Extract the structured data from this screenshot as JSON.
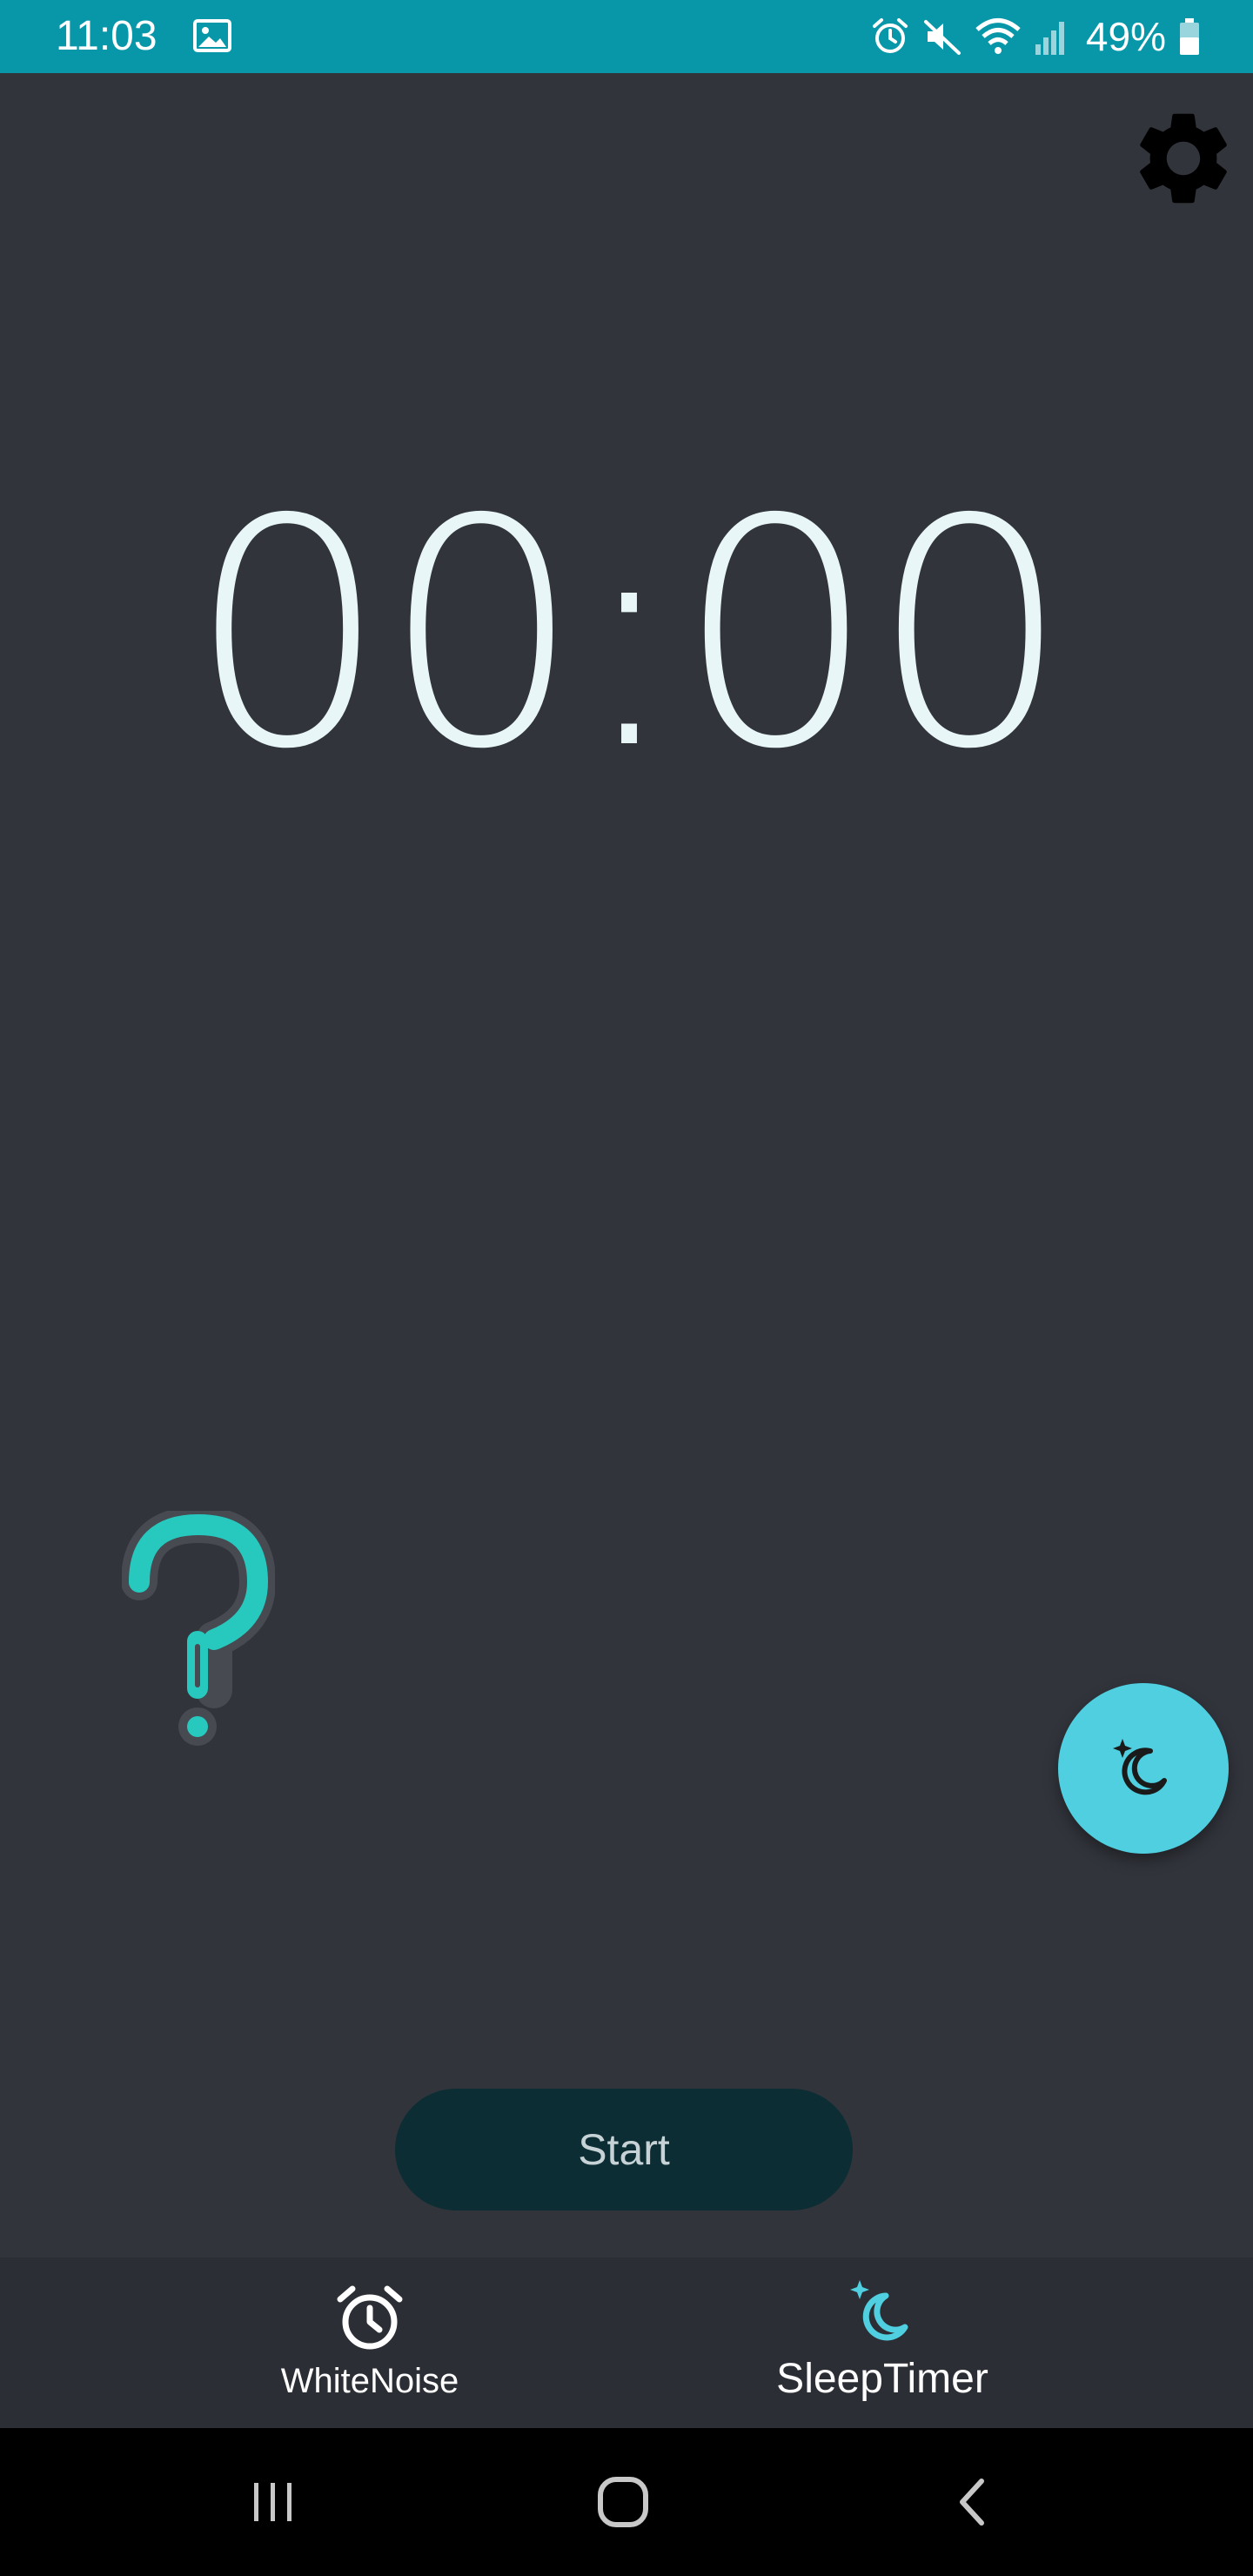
{
  "status_bar": {
    "time": "11:03",
    "battery": "49%",
    "icons": [
      "gallery-icon",
      "alarm-icon",
      "mute-icon",
      "wifi-icon",
      "signal-icon",
      "battery-icon"
    ],
    "color": "#0797a9"
  },
  "settings": {
    "icon": "gear-icon"
  },
  "timer": {
    "display": "00:00",
    "color": "#e8f6f8"
  },
  "help": {
    "icon": "question-mark-icon",
    "color": "#27c9be"
  },
  "fab": {
    "icon": "moon-star-icon",
    "color": "#4fcfdf"
  },
  "start_button": {
    "label": "Start",
    "color": "#0b2d33"
  },
  "bottom_nav": {
    "items": [
      {
        "label": "WhiteNoise",
        "icon": "alarm-clock-icon",
        "active": false
      },
      {
        "label": "SleepTimer",
        "icon": "moon-star-icon",
        "active": true
      }
    ],
    "active_color": "#4fcfdf"
  },
  "system_nav": {
    "buttons": [
      "recents-icon",
      "home-icon",
      "back-icon"
    ]
  }
}
